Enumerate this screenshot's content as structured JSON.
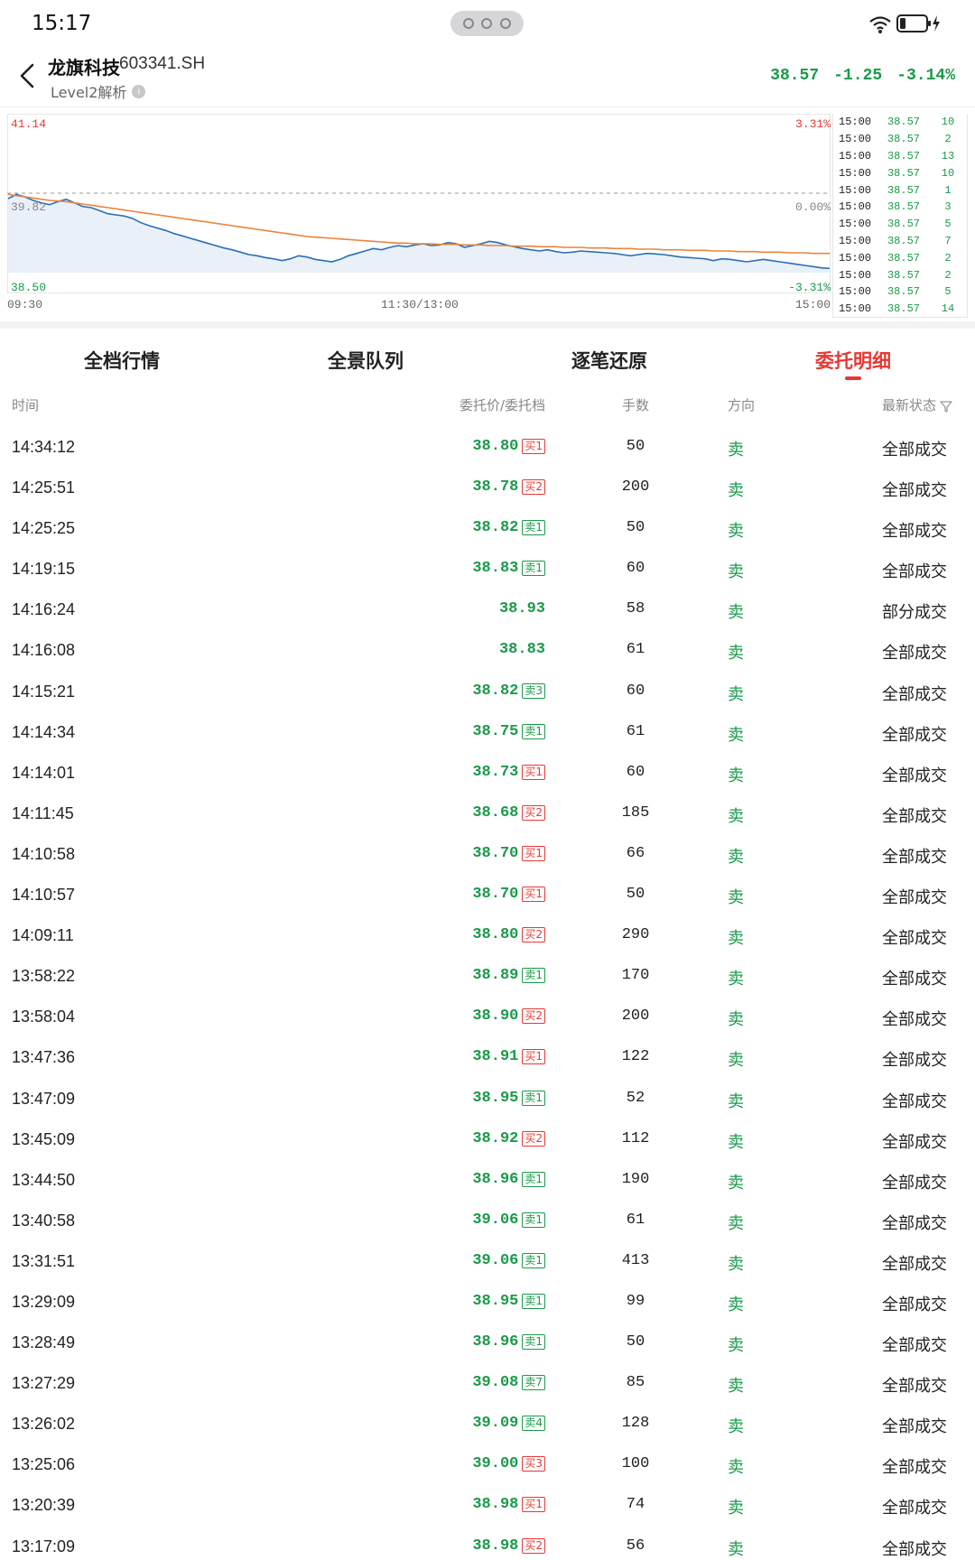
{
  "status": {
    "time": "15:17"
  },
  "header": {
    "name": "龙旗科技",
    "code": "603341.SH",
    "sub": "Level2解析",
    "price": "38.57",
    "change": "-1.25",
    "change_pct": "-3.14%"
  },
  "chart": {
    "top_left": "41.14",
    "top_right": "3.31%",
    "mid_left": "39.82",
    "mid_right": "0.00%",
    "bottom_left": "38.50",
    "bottom_right": "-3.31%",
    "x_start": "09:30",
    "x_mid": "11:30/13:00",
    "x_end": "15:00"
  },
  "chart_data": {
    "type": "line",
    "ylim": [
      38.5,
      41.14
    ],
    "series": [
      {
        "values": [
          39.73,
          39.8,
          39.76,
          39.7,
          39.66,
          39.63,
          39.68,
          39.72,
          39.66,
          39.6,
          39.58,
          39.53,
          39.48,
          39.46,
          39.44,
          39.4,
          39.33,
          39.28,
          39.24,
          39.2,
          39.15,
          39.11,
          39.07,
          39.03,
          38.99,
          38.95,
          38.91,
          38.88,
          38.84,
          38.8,
          38.78,
          38.75,
          38.73,
          38.7,
          38.73,
          38.78,
          38.76,
          38.72,
          38.7,
          38.68,
          38.72,
          38.78,
          38.82,
          38.86,
          38.9,
          38.88,
          38.92,
          38.95,
          38.93,
          38.96,
          38.98,
          38.95,
          38.96,
          39.0,
          38.98,
          38.92,
          38.95,
          38.98,
          39.02,
          39.0,
          38.96,
          38.93,
          38.9,
          38.88,
          38.86,
          38.88,
          38.85,
          38.83,
          38.84,
          38.86,
          38.85,
          38.84,
          38.83,
          38.82,
          38.8,
          38.78,
          38.8,
          38.82,
          38.81,
          38.8,
          38.78,
          38.76,
          38.75,
          38.74,
          38.73,
          38.7,
          38.73,
          38.72,
          38.7,
          38.68,
          38.7,
          38.72,
          38.7,
          38.68,
          38.66,
          38.64,
          38.62,
          38.6,
          38.58,
          38.57
        ]
      },
      {
        "values": [
          39.8,
          39.78,
          39.76,
          39.74,
          39.72,
          39.7,
          39.69,
          39.68,
          39.66,
          39.64,
          39.62,
          39.6,
          39.58,
          39.56,
          39.54,
          39.52,
          39.5,
          39.48,
          39.46,
          39.44,
          39.42,
          39.4,
          39.38,
          39.36,
          39.34,
          39.32,
          39.3,
          39.28,
          39.26,
          39.24,
          39.22,
          39.2,
          39.18,
          39.16,
          39.14,
          39.12,
          39.1,
          39.09,
          39.08,
          39.07,
          39.06,
          39.05,
          39.04,
          39.03,
          39.02,
          39.01,
          39.0,
          38.99,
          38.99,
          38.98,
          38.98,
          38.98,
          38.97,
          38.97,
          38.97,
          38.96,
          38.96,
          38.96,
          38.95,
          38.95,
          38.95,
          38.94,
          38.94,
          38.94,
          38.93,
          38.93,
          38.93,
          38.92,
          38.92,
          38.92,
          38.91,
          38.91,
          38.91,
          38.9,
          38.9,
          38.9,
          38.89,
          38.89,
          38.89,
          38.88,
          38.88,
          38.88,
          38.87,
          38.87,
          38.87,
          38.86,
          38.86,
          38.86,
          38.85,
          38.85,
          38.85,
          38.84,
          38.84,
          38.84,
          38.83,
          38.83,
          38.83,
          38.82,
          38.82,
          38.82
        ]
      }
    ]
  },
  "ticks": [
    {
      "t": "15:00",
      "p": "38.57",
      "v": "10"
    },
    {
      "t": "15:00",
      "p": "38.57",
      "v": "2"
    },
    {
      "t": "15:00",
      "p": "38.57",
      "v": "13"
    },
    {
      "t": "15:00",
      "p": "38.57",
      "v": "10"
    },
    {
      "t": "15:00",
      "p": "38.57",
      "v": "1"
    },
    {
      "t": "15:00",
      "p": "38.57",
      "v": "3"
    },
    {
      "t": "15:00",
      "p": "38.57",
      "v": "5"
    },
    {
      "t": "15:00",
      "p": "38.57",
      "v": "7"
    },
    {
      "t": "15:00",
      "p": "38.57",
      "v": "2"
    },
    {
      "t": "15:00",
      "p": "38.57",
      "v": "2"
    },
    {
      "t": "15:00",
      "p": "38.57",
      "v": "5"
    },
    {
      "t": "15:00",
      "p": "38.57",
      "v": "14"
    }
  ],
  "tabs": [
    "全档行情",
    "全景队列",
    "逐笔还原",
    "委托明细"
  ],
  "table_header": {
    "time": "时间",
    "price": "委托价/委托档",
    "qty": "手数",
    "dir": "方向",
    "status": "最新状态"
  },
  "rows": [
    {
      "time": "14:34:12",
      "price": "38.80",
      "badge": "买1",
      "side": "buy",
      "qty": "50",
      "dir": "卖",
      "status": "全部成交"
    },
    {
      "time": "14:25:51",
      "price": "38.78",
      "badge": "买2",
      "side": "buy",
      "qty": "200",
      "dir": "卖",
      "status": "全部成交"
    },
    {
      "time": "14:25:25",
      "price": "38.82",
      "badge": "卖1",
      "side": "sell",
      "qty": "50",
      "dir": "卖",
      "status": "全部成交"
    },
    {
      "time": "14:19:15",
      "price": "38.83",
      "badge": "卖1",
      "side": "sell",
      "qty": "60",
      "dir": "卖",
      "status": "全部成交"
    },
    {
      "time": "14:16:24",
      "price": "38.93",
      "badge": "",
      "side": "",
      "qty": "58",
      "dir": "卖",
      "status": "部分成交"
    },
    {
      "time": "14:16:08",
      "price": "38.83",
      "badge": "",
      "side": "",
      "qty": "61",
      "dir": "卖",
      "status": "全部成交"
    },
    {
      "time": "14:15:21",
      "price": "38.82",
      "badge": "卖3",
      "side": "sell",
      "qty": "60",
      "dir": "卖",
      "status": "全部成交"
    },
    {
      "time": "14:14:34",
      "price": "38.75",
      "badge": "卖1",
      "side": "sell",
      "qty": "61",
      "dir": "卖",
      "status": "全部成交"
    },
    {
      "time": "14:14:01",
      "price": "38.73",
      "badge": "买1",
      "side": "buy",
      "qty": "60",
      "dir": "卖",
      "status": "全部成交"
    },
    {
      "time": "14:11:45",
      "price": "38.68",
      "badge": "买2",
      "side": "buy",
      "qty": "185",
      "dir": "卖",
      "status": "全部成交"
    },
    {
      "time": "14:10:58",
      "price": "38.70",
      "badge": "买1",
      "side": "buy",
      "qty": "66",
      "dir": "卖",
      "status": "全部成交"
    },
    {
      "time": "14:10:57",
      "price": "38.70",
      "badge": "买1",
      "side": "buy",
      "qty": "50",
      "dir": "卖",
      "status": "全部成交"
    },
    {
      "time": "14:09:11",
      "price": "38.80",
      "badge": "买2",
      "side": "buy",
      "qty": "290",
      "dir": "卖",
      "status": "全部成交"
    },
    {
      "time": "13:58:22",
      "price": "38.89",
      "badge": "卖1",
      "side": "sell",
      "qty": "170",
      "dir": "卖",
      "status": "全部成交"
    },
    {
      "time": "13:58:04",
      "price": "38.90",
      "badge": "买2",
      "side": "buy",
      "qty": "200",
      "dir": "卖",
      "status": "全部成交"
    },
    {
      "time": "13:47:36",
      "price": "38.91",
      "badge": "买1",
      "side": "buy",
      "qty": "122",
      "dir": "卖",
      "status": "全部成交"
    },
    {
      "time": "13:47:09",
      "price": "38.95",
      "badge": "卖1",
      "side": "sell",
      "qty": "52",
      "dir": "卖",
      "status": "全部成交"
    },
    {
      "time": "13:45:09",
      "price": "38.92",
      "badge": "买2",
      "side": "buy",
      "qty": "112",
      "dir": "卖",
      "status": "全部成交"
    },
    {
      "time": "13:44:50",
      "price": "38.96",
      "badge": "卖1",
      "side": "sell",
      "qty": "190",
      "dir": "卖",
      "status": "全部成交"
    },
    {
      "time": "13:40:58",
      "price": "39.06",
      "badge": "卖1",
      "side": "sell",
      "qty": "61",
      "dir": "卖",
      "status": "全部成交"
    },
    {
      "time": "13:31:51",
      "price": "39.06",
      "badge": "卖1",
      "side": "sell",
      "qty": "413",
      "dir": "卖",
      "status": "全部成交"
    },
    {
      "time": "13:29:09",
      "price": "38.95",
      "badge": "卖1",
      "side": "sell",
      "qty": "99",
      "dir": "卖",
      "status": "全部成交"
    },
    {
      "time": "13:28:49",
      "price": "38.96",
      "badge": "卖1",
      "side": "sell",
      "qty": "50",
      "dir": "卖",
      "status": "全部成交"
    },
    {
      "time": "13:27:29",
      "price": "39.08",
      "badge": "卖7",
      "side": "sell",
      "qty": "85",
      "dir": "卖",
      "status": "全部成交"
    },
    {
      "time": "13:26:02",
      "price": "39.09",
      "badge": "卖4",
      "side": "sell",
      "qty": "128",
      "dir": "卖",
      "status": "全部成交"
    },
    {
      "time": "13:25:06",
      "price": "39.00",
      "badge": "买3",
      "side": "buy",
      "qty": "100",
      "dir": "卖",
      "status": "全部成交"
    },
    {
      "time": "13:20:39",
      "price": "38.98",
      "badge": "买1",
      "side": "buy",
      "qty": "74",
      "dir": "卖",
      "status": "全部成交"
    },
    {
      "time": "13:17:09",
      "price": "38.98",
      "badge": "买2",
      "side": "buy",
      "qty": "56",
      "dir": "卖",
      "status": "全部成交"
    }
  ],
  "colors": {
    "up": "#e53935",
    "down": "#1a9a4a",
    "avg": "#e8853d",
    "price_line": "#2a6fb8"
  }
}
